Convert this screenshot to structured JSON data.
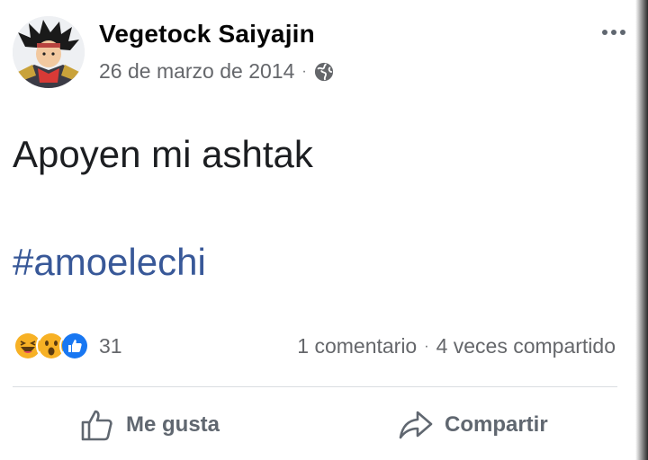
{
  "post": {
    "author": "Vegetock Saiyajin",
    "date": "26 de marzo de 2014",
    "separator": "·",
    "privacy_icon": "globe-icon",
    "text": "Apoyen mi ashtak",
    "hashtag": "#amoelechi",
    "reactions": {
      "icons": [
        "laugh-reaction-icon",
        "wow-reaction-icon",
        "like-reaction-icon"
      ],
      "count": "31"
    },
    "stats": {
      "comments": "1 comentario",
      "separator": "·",
      "shares": "4 veces compartido"
    }
  },
  "actions": {
    "like_label": "Me gusta",
    "share_label": "Compartir"
  },
  "colors": {
    "hashtag": "#385898",
    "secondary_text": "#65676b",
    "like_blue": "#1877f2",
    "reaction_yellow": "#f7b125"
  }
}
